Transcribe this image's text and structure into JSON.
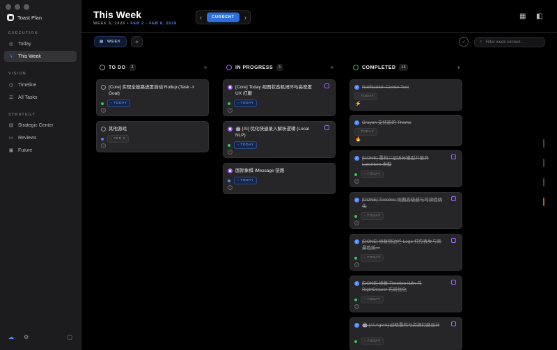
{
  "app": {
    "name": "Toast Plan"
  },
  "sidebar": {
    "sections": [
      {
        "label": "EXECUTION",
        "items": [
          {
            "label": "Today",
            "icon": "target-icon"
          },
          {
            "label": "This Week",
            "icon": "bolt-icon",
            "active": true
          }
        ]
      },
      {
        "label": "VISION",
        "items": [
          {
            "label": "Timeline",
            "icon": "clock-icon"
          },
          {
            "label": "All Tasks",
            "icon": "list-icon"
          }
        ]
      },
      {
        "label": "STRATEGY",
        "items": [
          {
            "label": "Strategic Center",
            "icon": "layers-icon"
          },
          {
            "label": "Reviews",
            "icon": "doc-icon"
          },
          {
            "label": "Future",
            "icon": "box-icon"
          }
        ]
      }
    ]
  },
  "header": {
    "title": "This Week",
    "week_label": "WEEK 6, 2026",
    "separator": "•",
    "date_range": "FEB 2 - FEB 8, 2026",
    "current_label": "CURRENT",
    "prev": "‹",
    "next": "›"
  },
  "toolbar": {
    "view_label": "WEEK",
    "filter_placeholder": "Filter week context..."
  },
  "columns": [
    {
      "title": "TO DO",
      "count": "2",
      "ring_color": "#aaaaaa",
      "cards": [
        {
          "text": "[Core] 实现全链路进度自动 Rollup (Task -> Goal)",
          "dot": "#34c759",
          "tag": "TODAY",
          "tag_style": "today",
          "status": "todo"
        },
        {
          "text": "其他游戏",
          "dot": "#4f8cff",
          "tag": "FEB 2",
          "tag_style": "date",
          "status": "todo"
        }
      ]
    },
    {
      "title": "IN PROGRESS",
      "count": "3",
      "ring_color": "#a066ff",
      "cards": [
        {
          "text": "[Core] Today 视图状态机闭环与高密度 UX 打磨",
          "dot": "#34c759",
          "tag": "TODAY",
          "tag_style": "today",
          "status": "prog",
          "mark": true
        },
        {
          "text": "🤖 [AI] 优化快速录入解析逻辑 (Local NLP)",
          "dot": "#34c759",
          "tag": "TODAY",
          "tag_style": "today",
          "status": "prog",
          "mark": true
        },
        {
          "text": "国际象棋 iMessage 链路",
          "dot": "#4f8cff",
          "tag": "TODAY",
          "tag_style": "today",
          "status": "prog"
        }
      ]
    },
    {
      "title": "COMPLETED",
      "count": "16",
      "ring_color": "#34c759",
      "cards": [
        {
          "text": "Notification Center Test",
          "tag": "TODAY",
          "tag_style": "today-done",
          "status": "done",
          "emoji": "⚡"
        },
        {
          "text": "Crayon 支持新的 Theme",
          "tag": "TODAY",
          "tag_style": "today-done",
          "status": "done",
          "emoji": "🔥"
        },
        {
          "text": "[DONE] 重构二层拆分模型并废弃 LaterItem 类型",
          "dot": "#34c759",
          "tag": "TODAY",
          "tag_style": "today-done",
          "status": "done",
          "mark": true
        },
        {
          "text": "[DONE] Timeline 视图高级感与可读性优化",
          "dot": "#34c759",
          "tag": "TODAY",
          "tag_style": "today-done",
          "status": "done",
          "mark": true
        },
        {
          "text": "[DONE] 修复侧边栏 Logo 打包丢失与背景色统一",
          "dot": "#34c759",
          "tag": "TODAY",
          "tag_style": "today-done",
          "status": "done",
          "mark": true
        },
        {
          "text": "[DONE] 修复 Timeline i18n 与 RightDrawer 布局优化",
          "dot": "#34c759",
          "tag": "TODAY",
          "tag_style": "today-done",
          "status": "done",
          "mark": true
        },
        {
          "text": "🤖 [AI Agent] 战略重构与资源打磨设计",
          "dot": "#34c759",
          "tag": "TODAY",
          "tag_style": "today-done",
          "status": "done",
          "mark": true
        }
      ]
    }
  ]
}
